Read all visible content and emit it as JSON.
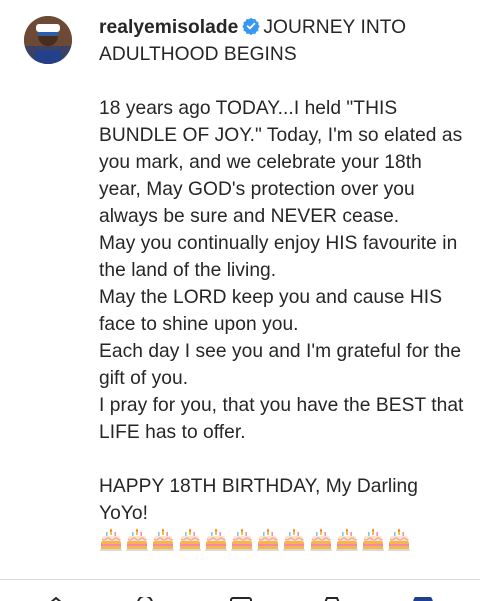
{
  "post": {
    "username": "realyemisolade",
    "caption_lines": [
      "JOURNEY INTO ADULTHOOD BEGINS",
      "18 years ago TODAY...I held \"THIS BUNDLE OF JOY.\" Today, I'm so elated as you mark, and we celebrate your 18th year, May GOD's protection over you always be sure and NEVER cease.",
      "May you continually enjoy HIS favourite in the land of the living.",
      "May the LORD keep you and cause HIS face to shine upon you.",
      "Each day I see you and I'm grateful for the gift of you.",
      "I pray for you, that you have the BEST that LIFE has to offer.",
      "HAPPY 18TH BIRTHDAY, My Darling YoYo!"
    ],
    "emoji_count": 12,
    "emoji_name": "birthday-cake-icon"
  },
  "colors": {
    "text": "#262626",
    "verified": "#3897f0"
  },
  "bottom_nav": {
    "icons": [
      "home-icon",
      "search-icon",
      "reels-icon",
      "shop-icon",
      "profile-icon"
    ]
  }
}
